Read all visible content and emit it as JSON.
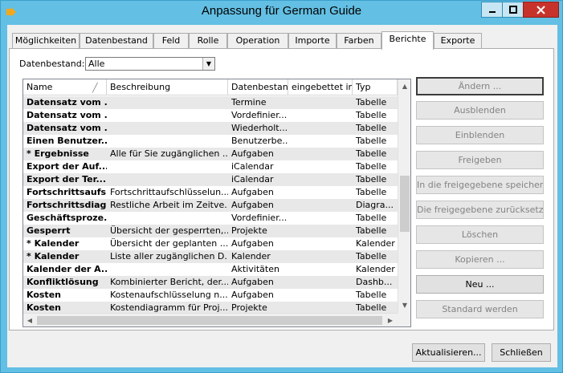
{
  "window": {
    "title": "Anpassung für German Guide"
  },
  "tabs": [
    {
      "label": "Möglichkeiten",
      "active": false
    },
    {
      "label": "Datenbestand",
      "active": false
    },
    {
      "label": "Feld",
      "active": false
    },
    {
      "label": "Rolle",
      "active": false
    },
    {
      "label": "Operation",
      "active": false
    },
    {
      "label": "Importe",
      "active": false
    },
    {
      "label": "Farben",
      "active": false
    },
    {
      "label": "Berichte",
      "active": true
    },
    {
      "label": "Exporte",
      "active": false
    }
  ],
  "filter": {
    "label": "Datenbestand:",
    "value": "Alle"
  },
  "table": {
    "columns": [
      "Name",
      "Beschreibung",
      "Datenbestan",
      "eingebettet in",
      "Typ"
    ],
    "rows": [
      [
        "Datensatz vom ...",
        "",
        "Termine",
        "",
        "Tabelle"
      ],
      [
        "Datensatz vom ...",
        "",
        "Vordefinier...",
        "",
        "Tabelle"
      ],
      [
        "Datensatz vom ...",
        "",
        "Wiederholt...",
        "",
        "Tabelle"
      ],
      [
        "Einen Benutzer...",
        "",
        "Benutzerbe...",
        "",
        "Tabelle"
      ],
      [
        "* Ergebnisse",
        "Alle für Sie zugänglichen ...",
        "Aufgaben",
        "",
        "Tabelle"
      ],
      [
        "Export der Auf...",
        "",
        "iCalendar",
        "",
        "Tabelle"
      ],
      [
        "Export der Ter...",
        "",
        "iCalendar",
        "",
        "Tabelle"
      ],
      [
        "Fortschrittsaufs...",
        "Fortschrittaufschlüsselun...",
        "Aufgaben",
        "",
        "Tabelle"
      ],
      [
        "Fortschrittsdiag...",
        "Restliche Arbeit im Zeitve...",
        "Aufgaben",
        "",
        "Diagra..."
      ],
      [
        "Geschäftsproze...",
        "",
        "Vordefinier...",
        "",
        "Tabelle"
      ],
      [
        "Gesperrt",
        "Übersicht der gesperrten,...",
        "Projekte",
        "",
        "Tabelle"
      ],
      [
        "* Kalender",
        "Übersicht der geplanten ...",
        "Aufgaben",
        "",
        "Kalender"
      ],
      [
        "* Kalender",
        "Liste aller zugänglichen D...",
        "Kalender",
        "",
        "Tabelle"
      ],
      [
        "Kalender der A...",
        "",
        "Aktivitäten",
        "",
        "Kalender"
      ],
      [
        "Konfliktlösung",
        "Kombinierter Bericht, der...",
        "Aufgaben",
        "",
        "Dashb..."
      ],
      [
        "Kosten",
        "Kostenaufschlüsselung n...",
        "Aufgaben",
        "",
        "Tabelle"
      ],
      [
        "Kosten",
        "Kostendiagramm für Proj...",
        "Projekte",
        "",
        "Tabelle"
      ]
    ]
  },
  "actions": [
    {
      "label": "Ändern ...",
      "enabled": false
    },
    {
      "label": "Ausblenden",
      "enabled": false
    },
    {
      "label": "Einblenden",
      "enabled": false
    },
    {
      "label": "Freigeben",
      "enabled": false
    },
    {
      "label": "In die freigegebene speichern",
      "enabled": false
    },
    {
      "label": "Die freigegebene zurücksetzen",
      "enabled": false
    },
    {
      "label": "Löschen",
      "enabled": false
    },
    {
      "label": "Kopieren ...",
      "enabled": false
    },
    {
      "label": "Neu ...",
      "enabled": true
    },
    {
      "label": "Standard werden",
      "enabled": false
    }
  ],
  "footer": {
    "refresh_label": "Aktualisieren...",
    "close_label": "Schließen"
  },
  "colors": {
    "titlebar": "#63bfe3",
    "close": "#c7332b",
    "row_alt": "#e8e8e8"
  }
}
